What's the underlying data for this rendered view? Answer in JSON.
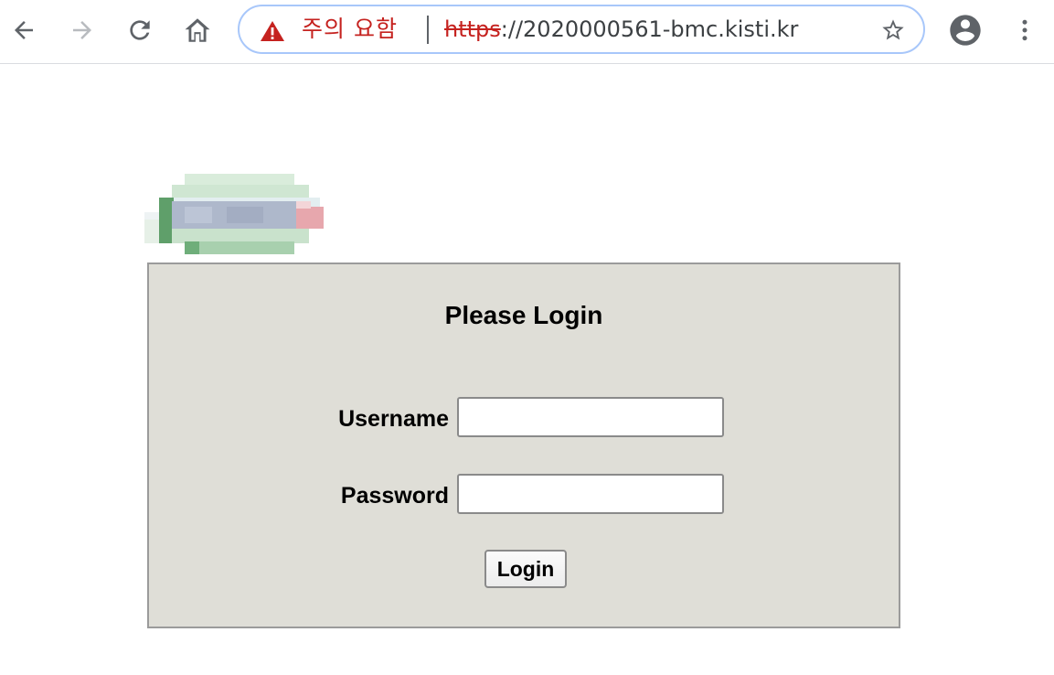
{
  "browser": {
    "security_warning": "주의 요함",
    "url_scheme": "https",
    "url_rest": "://2020000561-bmc.kisti.kr",
    "icons": {
      "back": "arrow-left-icon",
      "forward": "arrow-right-icon",
      "reload": "reload-icon",
      "home": "home-icon",
      "warning": "warning-triangle-icon",
      "bookmark": "star-icon",
      "profile": "account-circle-icon",
      "menu": "kebab-menu-icon"
    },
    "colors": {
      "warning": "#c5221f",
      "omnibox_border": "#a8c7fa"
    }
  },
  "page": {
    "logo": "pixelated-logo",
    "login": {
      "title": "Please Login",
      "username_label": "Username",
      "username_value": "",
      "password_label": "Password",
      "password_value": "",
      "submit_label": "Login"
    },
    "colors": {
      "panel_background": "#dfded7",
      "panel_border": "#9b9b9b"
    }
  }
}
